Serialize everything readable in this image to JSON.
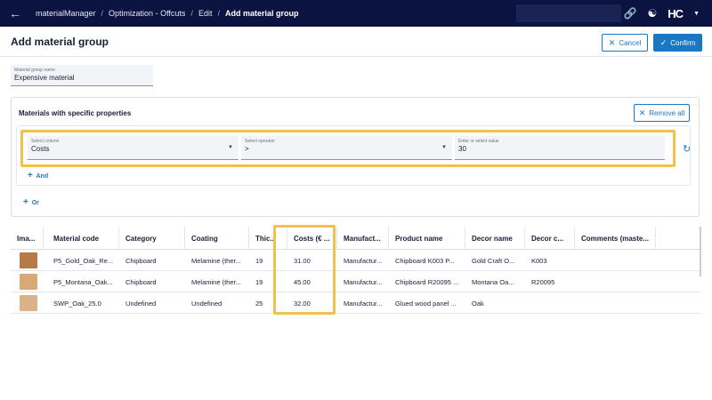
{
  "topbar": {
    "breadcrumbs": [
      "materialManager",
      "Optimization - Offcuts",
      "Edit",
      "Add material group"
    ],
    "logo": "HC"
  },
  "header": {
    "title": "Add material group",
    "cancel_label": "Cancel",
    "confirm_label": "Confirm"
  },
  "name_field": {
    "label": "Material group name",
    "value": "Expensive material"
  },
  "panel": {
    "title": "Materials with specific properties",
    "remove_all_label": "Remove all",
    "condition": {
      "column": {
        "label": "Select column",
        "value": "Costs"
      },
      "operator": {
        "label": "Select operator",
        "value": ">"
      },
      "value": {
        "label": "Enter or select value",
        "value": "30"
      }
    },
    "and_label": "And",
    "or_label": "Or"
  },
  "table": {
    "headers": [
      "Ima...",
      "Material code",
      "Category",
      "Coating",
      "Thic...",
      "Costs (€ ...",
      "Manufact...",
      "Product name",
      "Decor name",
      "Decor c...",
      "Comments (maste..."
    ],
    "rows": [
      {
        "swatch": "#b57a46",
        "code": "P5_Gold_Oak_Re...",
        "category": "Chipboard",
        "coating": "Melamine (ther...",
        "thickness": "19",
        "costs": "31.00",
        "manufacturer": "Manufactur...",
        "product": "Chipboard K003 P...",
        "decor_name": "Gold Craft O...",
        "decor_code": "K003",
        "comments": ""
      },
      {
        "swatch": "#d9a877",
        "code": "P5_Montana_Oak...",
        "category": "Chipboard",
        "coating": "Melamine (ther...",
        "thickness": "19",
        "costs": "45.00",
        "manufacturer": "Manufactur...",
        "product": "Chipboard R20095 ...",
        "decor_name": "Montana Oa...",
        "decor_code": "R20095",
        "comments": ""
      },
      {
        "swatch": "#dcb389",
        "code": "SWP_Oak_25.0",
        "category": "Undefined",
        "coating": "Undefined",
        "thickness": "25",
        "costs": "32.00",
        "manufacturer": "Manufactur...",
        "product": "Glued wood panel ...",
        "decor_name": "Oak",
        "decor_code": "",
        "comments": ""
      }
    ]
  }
}
